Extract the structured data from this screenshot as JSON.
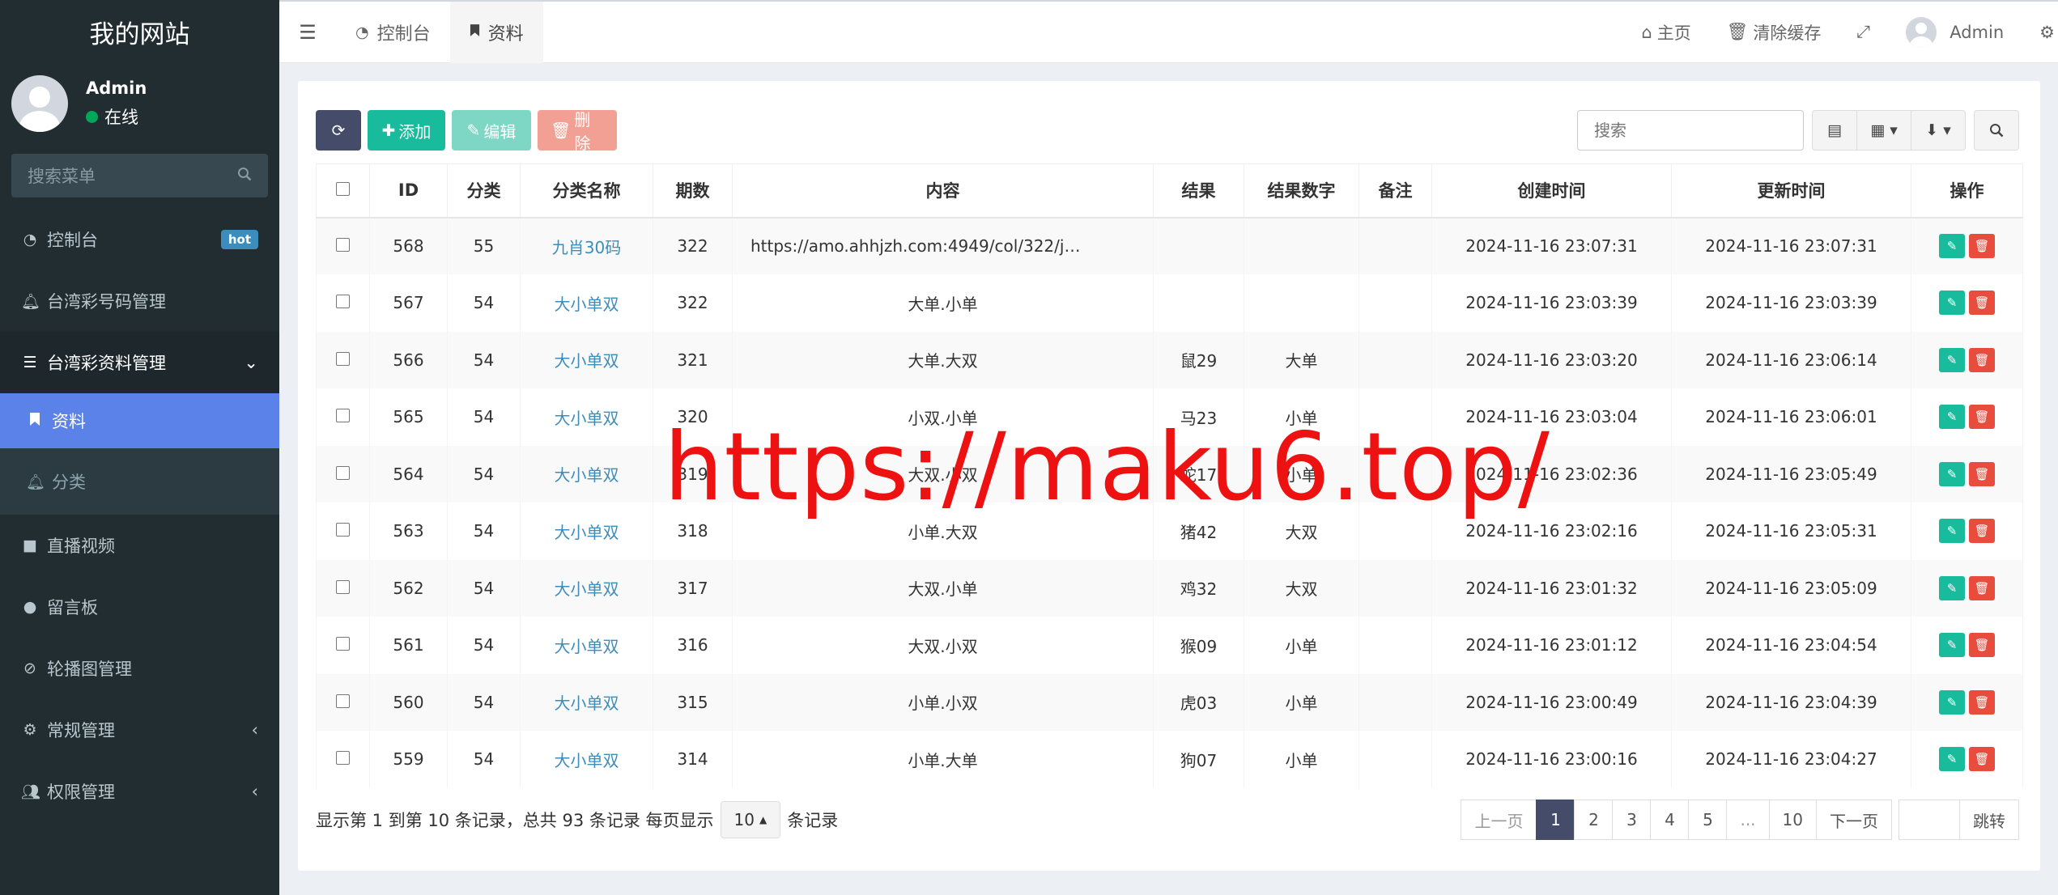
{
  "sidebar": {
    "brand": "我的网站",
    "user": {
      "name": "Admin",
      "status": "在线"
    },
    "search_placeholder": "搜索菜单",
    "items": [
      {
        "label": "控制台",
        "badge": "hot"
      },
      {
        "label": "台湾彩号码管理"
      },
      {
        "label": "台湾彩资料管理"
      },
      {
        "label": "资料"
      },
      {
        "label": "分类"
      },
      {
        "label": "直播视频"
      },
      {
        "label": "留言板"
      },
      {
        "label": "轮播图管理"
      },
      {
        "label": "常规管理"
      },
      {
        "label": "权限管理"
      }
    ]
  },
  "header": {
    "tabs": [
      {
        "label": "控制台"
      },
      {
        "label": "资料"
      }
    ],
    "links": {
      "home": "主页",
      "clear_cache": "清除缓存",
      "user": "Admin"
    }
  },
  "toolbar": {
    "add": "添加",
    "edit": "编辑",
    "delete": "删除",
    "search_placeholder": "搜索"
  },
  "table": {
    "headers": [
      "ID",
      "分类",
      "分类名称",
      "期数",
      "内容",
      "结果",
      "结果数字",
      "备注",
      "创建时间",
      "更新时间",
      "操作"
    ],
    "rows": [
      [
        "568",
        "55",
        "九肖30码",
        "322",
        "https://amo.ahhjzh.com:4949/col/322/j…",
        "",
        "",
        "",
        "2024-11-16 23:07:31",
        "2024-11-16 23:07:31"
      ],
      [
        "567",
        "54",
        "大小单双",
        "322",
        "大单.小单",
        "",
        "",
        "",
        "2024-11-16 23:03:39",
        "2024-11-16 23:03:39"
      ],
      [
        "566",
        "54",
        "大小单双",
        "321",
        "大单.大双",
        "鼠29",
        "大单",
        "",
        "2024-11-16 23:03:20",
        "2024-11-16 23:06:14"
      ],
      [
        "565",
        "54",
        "大小单双",
        "320",
        "小双.小单",
        "马23",
        "小单",
        "",
        "2024-11-16 23:03:04",
        "2024-11-16 23:06:01"
      ],
      [
        "564",
        "54",
        "大小单双",
        "319",
        "大双.小双",
        "蛇17",
        "小单",
        "",
        "2024-11-16 23:02:36",
        "2024-11-16 23:05:49"
      ],
      [
        "563",
        "54",
        "大小单双",
        "318",
        "小单.大双",
        "猪42",
        "大双",
        "",
        "2024-11-16 23:02:16",
        "2024-11-16 23:05:31"
      ],
      [
        "562",
        "54",
        "大小单双",
        "317",
        "大双.小单",
        "鸡32",
        "大双",
        "",
        "2024-11-16 23:01:32",
        "2024-11-16 23:05:09"
      ],
      [
        "561",
        "54",
        "大小单双",
        "316",
        "大双.小双",
        "猴09",
        "小单",
        "",
        "2024-11-16 23:01:12",
        "2024-11-16 23:04:54"
      ],
      [
        "560",
        "54",
        "大小单双",
        "315",
        "小单.小双",
        "虎03",
        "小单",
        "",
        "2024-11-16 23:00:49",
        "2024-11-16 23:04:39"
      ],
      [
        "559",
        "54",
        "大小单双",
        "314",
        "小单.大单",
        "狗07",
        "小单",
        "",
        "2024-11-16 23:00:16",
        "2024-11-16 23:04:27"
      ]
    ]
  },
  "footer": {
    "info": "显示第 1 到第 10 条记录，总共 93 条记录 每页显示",
    "page_size": "10",
    "suffix": "条记录",
    "pagination": [
      "上一页",
      "1",
      "2",
      "3",
      "4",
      "5",
      "...",
      "10",
      "下一页"
    ],
    "jump": "跳转"
  },
  "watermark": "https://maku6.top/",
  "colors": {
    "sidebar": "#222d32",
    "active_menu": "#5b82e8",
    "add": "#18bc9c",
    "delete": "#e74c3c",
    "primary": "#444c69"
  }
}
